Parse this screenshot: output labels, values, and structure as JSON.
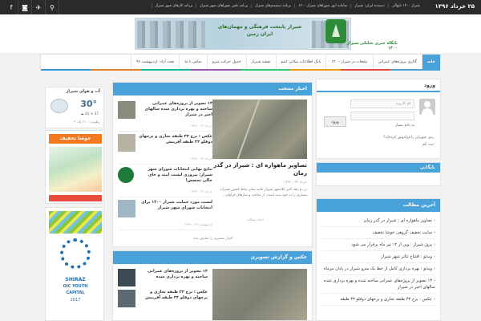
{
  "topbar": {
    "date": "۲۵ خرداد ۱۳۹۶",
    "links": [
      "شیراز ۱۴۰۰ تابع‌الی",
      "دستنده ایران: شیراز",
      "سامانه انور شوراهای شیراز ۱۴۰۰",
      "برنامه سیستم‌های شیراز",
      "برنامه تلفن شوراهای شهر شیراز",
      "برنامه کارهای شهر شیراز"
    ],
    "social_icons": [
      "facebook-icon",
      "instagram-icon",
      "telegram-icon",
      "search-icon"
    ]
  },
  "header": {
    "banner_text": "شیراز پایتخت فرهنگی و مهمان‌های ایران زمین",
    "logo_text": "پایگاه خبری تحلیلی شیراز ۱۴۰۰"
  },
  "nav": {
    "items": [
      "خانه",
      "گالری پروژه‌های عمرانی",
      "تبلیغات در شیراز ۱۴۰۰",
      "بانک اطلاعات مکانی ایمو",
      "نقشه شیراز",
      "جدول حرکت مترو",
      "تماس با ما",
      "بحث آزاد: اردیبهشت ۹۶"
    ],
    "colors": [
      "#4aa3d8",
      "#e74c3c",
      "#f39c12",
      "#2ecc71",
      "#9b59b6",
      "#1abc9c",
      "#e67e22",
      "#3498db"
    ]
  },
  "login": {
    "title": "ورود",
    "username_placeholder": "نام کاربری",
    "password_placeholder": "",
    "remember": "به یادم بسپار",
    "button": "ورود",
    "forgot": "رمز عبورتان را فراموش کرده‌اید؟",
    "register": "ثبت نام"
  },
  "archive": {
    "title": "بایگانی"
  },
  "latest": {
    "title": "آخرین مطالب",
    "items": [
      "تصاویر ماهواره ای : شیراز در گذر زمان",
      "سایت تخفیف گروهی خوشا تخفیف",
      "پروژ شیراز : وین از ۱۲ تیر ماه برقرار می شود",
      "ویدئو : افتتاح تئاتر شهر شیراز",
      "ویدئو : بهره برداری کامل از خط یک مترو شیراز در پایان تیرماه",
      "۱۳ تصویر از پروژه‌های عمرانی ساخته شده و بهره برداری شده سالهای اخیر در شیراز",
      "عکس : برج ۳۳ طبقه تجاری و برجهای دوقلو ۳۳ طبقه"
    ]
  },
  "picked": {
    "title": "اخبار منتخب",
    "feature_title": "تصاویر ماهواره ای : شیراز در گذر زمان",
    "feature_meta": "خرداد ۲۴ ، ۱۳۹۶  ۰",
    "feature_desc": "در دو دهه اخیر کلانشهر شیراز مانند سایر نقاط کشور تغییرات بسیاری را به خود دیده است. از ساخت و سازهای فراوان...",
    "feature_more": "ادامه مطلب",
    "items": [
      {
        "title": "۱۳ تصویر از پروژه‌های عمرانی ساخته و بهره برداری شده سالهای اخیر در شیراز",
        "date": "خرداد ۲۴ ، ۱۳۹۶"
      },
      {
        "title": "عکس : برج ۳۳ طبقه تجاری و برجهای دوقلو ۳۳ طبقه آفرینش",
        "date": "خرداد ۲۴ ، ۱۳۹۶"
      },
      {
        "title": "نتایج نهایی انتخابات شورای شهر شیراز: پیروزی لیست امید و جای خالی تخصص!",
        "date": "خرداد ۲۴ ، ۱۳۹۶"
      },
      {
        "title": "لیست مورد حمایت شیراز ۱۴۰۰ برای انتخابات شورای شهر شیراز",
        "date": "اردیبهشت ۲۴ ، ۱۳۹۶"
      }
    ],
    "more_text": "اخبار بیشتری را نمایش بده"
  },
  "photos": {
    "title": "عکس و گزارش تصویری",
    "items": [
      "۱۳ تصویر از پروژه‌های عمرانی ساخته و بهره برداری شده",
      "عکس : برج ۳۳ طبقه تجاری و برجهای دوقلو ۳۳ طبقه آفرینش"
    ]
  },
  "weather": {
    "title": "آب و هوای شیراز",
    "temp": "30°",
    "stats": "37 ☀  20 ☁",
    "meta": "رطوبت: ۱۰٪   باد: ۳"
  },
  "ads": {
    "brand": "خوشا تخفیف",
    "shiraz_title": "SHIRAZ",
    "shiraz_sub": "OIC YOUTH",
    "shiraz_cap": "CAPITAL",
    "shiraz_year": "2017"
  }
}
